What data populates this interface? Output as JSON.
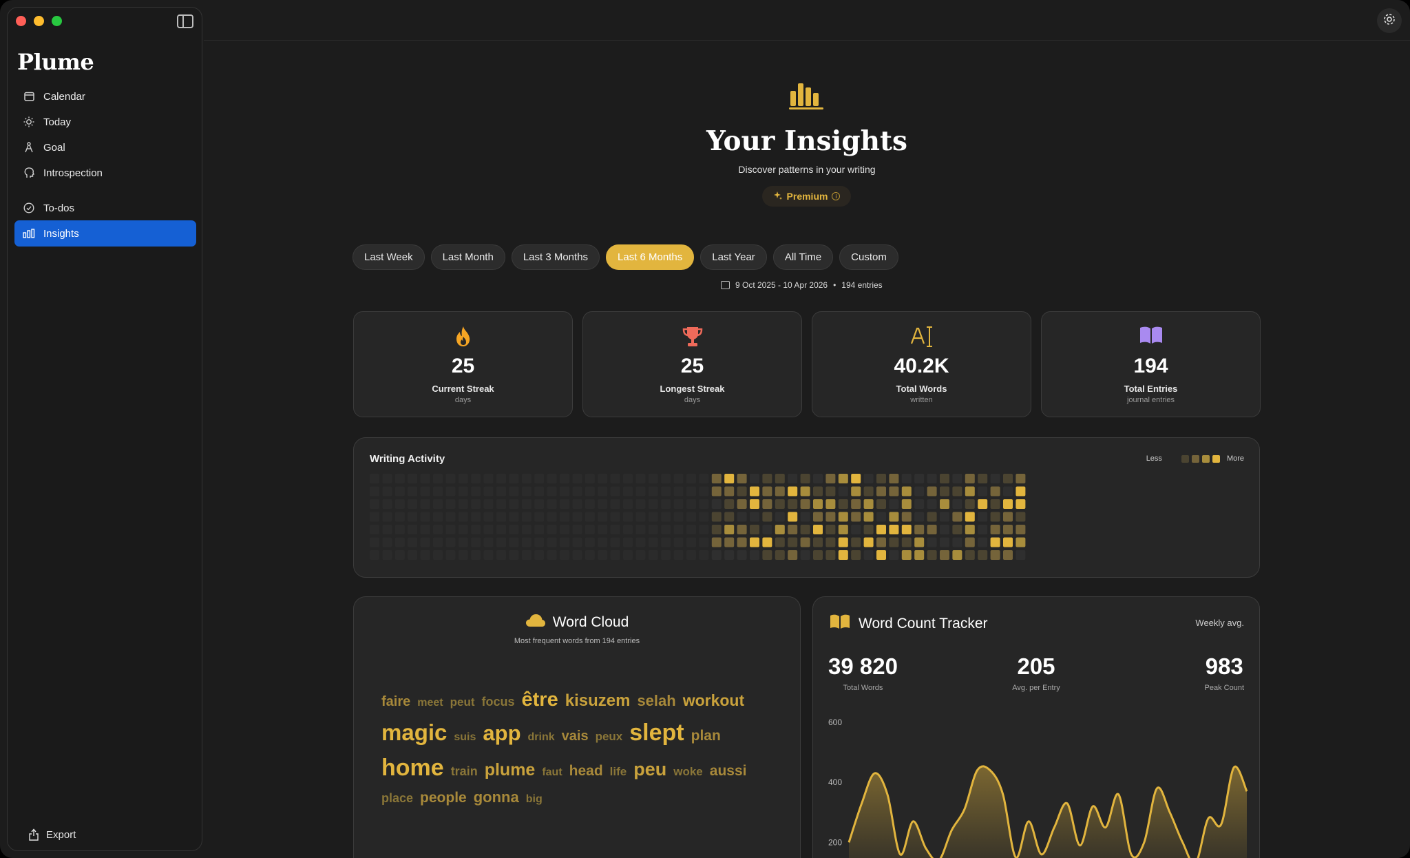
{
  "app": {
    "name": "Plume"
  },
  "sidebar": {
    "items": [
      {
        "label": "Calendar",
        "icon": "calendar-icon"
      },
      {
        "label": "Today",
        "icon": "sun-icon"
      },
      {
        "label": "Goal",
        "icon": "compass-icon"
      },
      {
        "label": "Introspection",
        "icon": "head-icon"
      },
      {
        "label": "To-dos",
        "icon": "check-circle-icon"
      },
      {
        "label": "Insights",
        "icon": "bar-chart-icon",
        "active": true
      }
    ],
    "export_label": "Export"
  },
  "hero": {
    "title": "Your Insights",
    "subtitle": "Discover patterns in your writing",
    "premium_label": "Premium"
  },
  "ranges": [
    {
      "label": "Last Week"
    },
    {
      "label": "Last Month"
    },
    {
      "label": "Last 3 Months"
    },
    {
      "label": "Last 6 Months",
      "active": true
    },
    {
      "label": "Last Year"
    },
    {
      "label": "All Time"
    },
    {
      "label": "Custom"
    }
  ],
  "date_range": {
    "text": "9 Oct 2025 - 10 Apr 2026",
    "separator": "•",
    "entries": "194 entries"
  },
  "stats": [
    {
      "value": "25",
      "label": "Current Streak",
      "sublabel": "days",
      "icon": "flame-icon",
      "color": "#f5a524"
    },
    {
      "value": "25",
      "label": "Longest Streak",
      "sublabel": "days",
      "icon": "trophy-icon",
      "color": "#ef6a5a"
    },
    {
      "value": "40.2K",
      "label": "Total Words",
      "sublabel": "written",
      "icon": "text-cursor-icon",
      "color": "#e2b53e"
    },
    {
      "value": "194",
      "label": "Total Entries",
      "sublabel": "journal entries",
      "icon": "book-icon",
      "color": "#a98af0"
    }
  ],
  "activity": {
    "title": "Writing Activity",
    "legend_less": "Less",
    "legend_more": "More",
    "colors": [
      "#2f2f2f",
      "#4b4431",
      "#75643a",
      "#a88d3c",
      "#e2b53e"
    ],
    "weeks": 52,
    "active_from_week": 27
  },
  "wordcloud": {
    "title": "Word Cloud",
    "subtitle": "Most frequent words from 194 entries",
    "words": [
      {
        "text": "faire",
        "size": 20,
        "level": 2
      },
      {
        "text": "meet",
        "size": 16,
        "level": 1
      },
      {
        "text": "peut",
        "size": 17,
        "level": 1
      },
      {
        "text": "focus",
        "size": 18,
        "level": 1
      },
      {
        "text": "être",
        "size": 29,
        "level": 4
      },
      {
        "text": "kisuzem",
        "size": 24,
        "level": 3
      },
      {
        "text": "selah",
        "size": 22,
        "level": 2
      },
      {
        "text": "workout",
        "size": 23,
        "level": 3
      },
      {
        "text": "magic",
        "size": 33,
        "level": 4
      },
      {
        "text": "suis",
        "size": 16,
        "level": 1
      },
      {
        "text": "app",
        "size": 31,
        "level": 4
      },
      {
        "text": "drink",
        "size": 16,
        "level": 1
      },
      {
        "text": "vais",
        "size": 20,
        "level": 2
      },
      {
        "text": "peux",
        "size": 17,
        "level": 1
      },
      {
        "text": "slept",
        "size": 34,
        "level": 4
      },
      {
        "text": "plan",
        "size": 21,
        "level": 2
      },
      {
        "text": "home",
        "size": 34,
        "level": 4
      },
      {
        "text": "train",
        "size": 18,
        "level": 1
      },
      {
        "text": "plume",
        "size": 25,
        "level": 3
      },
      {
        "text": "faut",
        "size": 16,
        "level": 1
      },
      {
        "text": "head",
        "size": 21,
        "level": 2
      },
      {
        "text": "life",
        "size": 17,
        "level": 1
      },
      {
        "text": "peu",
        "size": 27,
        "level": 3
      },
      {
        "text": "woke",
        "size": 17,
        "level": 1
      },
      {
        "text": "aussi",
        "size": 21,
        "level": 2
      },
      {
        "text": "place",
        "size": 18,
        "level": 1
      },
      {
        "text": "people",
        "size": 21,
        "level": 2
      },
      {
        "text": "gonna",
        "size": 22,
        "level": 2
      },
      {
        "text": "big",
        "size": 16,
        "level": 1
      }
    ]
  },
  "tracker": {
    "title": "Word Count Tracker",
    "period": "Weekly avg.",
    "stats": [
      {
        "value": "39 820",
        "label": "Total Words"
      },
      {
        "value": "205",
        "label": "Avg. per Entry"
      },
      {
        "value": "983",
        "label": "Peak Count"
      }
    ]
  },
  "chart_data": {
    "type": "area",
    "title": "",
    "xlabel": "",
    "ylabel": "",
    "ylim": [
      100,
      650
    ],
    "yticks": [
      600,
      400,
      200
    ],
    "grid": false,
    "series": [
      {
        "values": [
          200,
          330,
          430,
          360,
          160,
          270,
          180,
          140,
          240,
          310,
          440,
          440,
          360,
          150,
          270,
          160,
          250,
          330,
          190,
          320,
          250,
          360,
          160,
          200,
          380,
          300,
          200,
          130,
          280,
          260,
          450,
          370
        ]
      }
    ]
  }
}
